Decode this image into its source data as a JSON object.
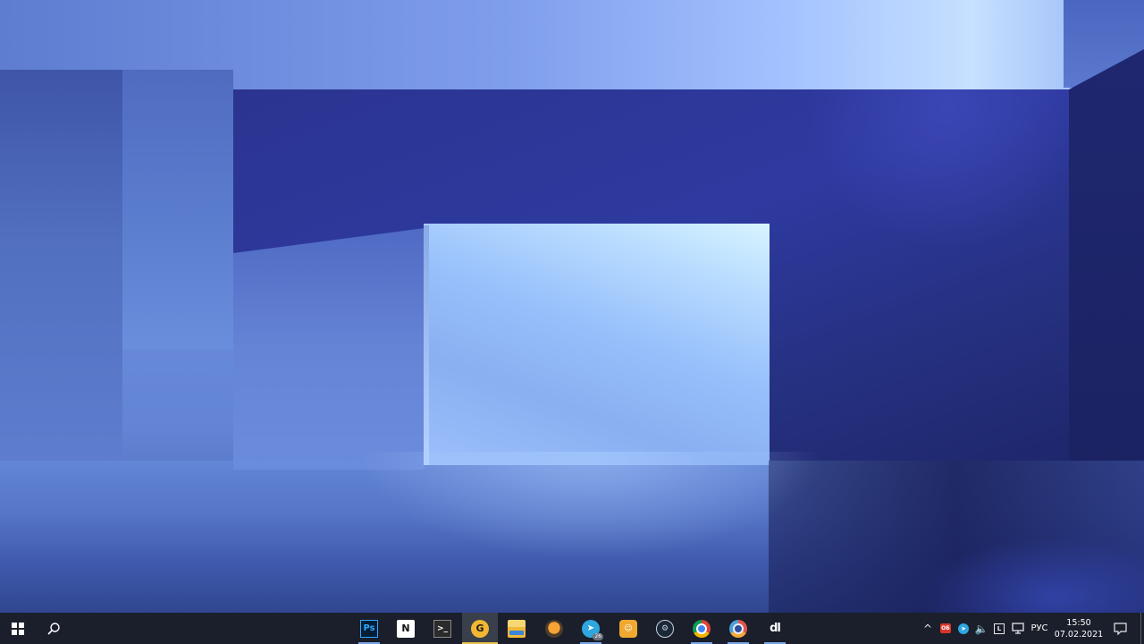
{
  "taskbar": {
    "start": {
      "icon": "windows-logo-icon"
    },
    "search": {
      "icon": "search-icon"
    },
    "apps": [
      {
        "id": "photoshop",
        "glyph": "Ps",
        "icon": "photoshop-icon",
        "running": true
      },
      {
        "id": "notion",
        "glyph": "N",
        "icon": "notion-icon",
        "running": false
      },
      {
        "id": "terminal",
        "glyph": ">_",
        "icon": "terminal-icon",
        "running": false
      },
      {
        "id": "pinned-app",
        "glyph": "G",
        "icon": "yellow-badge-app-icon",
        "running": true,
        "active": true
      },
      {
        "id": "file-explorer",
        "glyph": "",
        "icon": "folder-icon",
        "running": false
      },
      {
        "id": "fl-studio",
        "glyph": "",
        "icon": "fl-studio-icon",
        "running": false
      },
      {
        "id": "telegram",
        "glyph": "➤",
        "icon": "telegram-icon",
        "running": true,
        "badge": "26"
      },
      {
        "id": "discord",
        "glyph": "☺",
        "icon": "discord-icon",
        "running": false
      },
      {
        "id": "steam",
        "glyph": "⚙",
        "icon": "steam-icon",
        "running": false
      },
      {
        "id": "chrome",
        "glyph": "",
        "icon": "chrome-icon",
        "running": true
      },
      {
        "id": "chrome-dev",
        "glyph": "",
        "icon": "chrome-dev-icon",
        "running": true
      },
      {
        "id": "dl-app",
        "glyph": "dl",
        "icon": "dl-app-icon",
        "running": true
      }
    ],
    "tray": {
      "chevron": "^",
      "red_app_label": "OБ",
      "telegram_glyph": "➤",
      "sound_glyph": "🔈",
      "boxed_app_label": "L",
      "language": "РУС",
      "time": "15:50",
      "date": "07.02.2021"
    }
  },
  "colors": {
    "taskbar_bg": "#1a1f2b",
    "active_indicator": "#e8c14a",
    "running_indicator": "#7aa7e8"
  }
}
